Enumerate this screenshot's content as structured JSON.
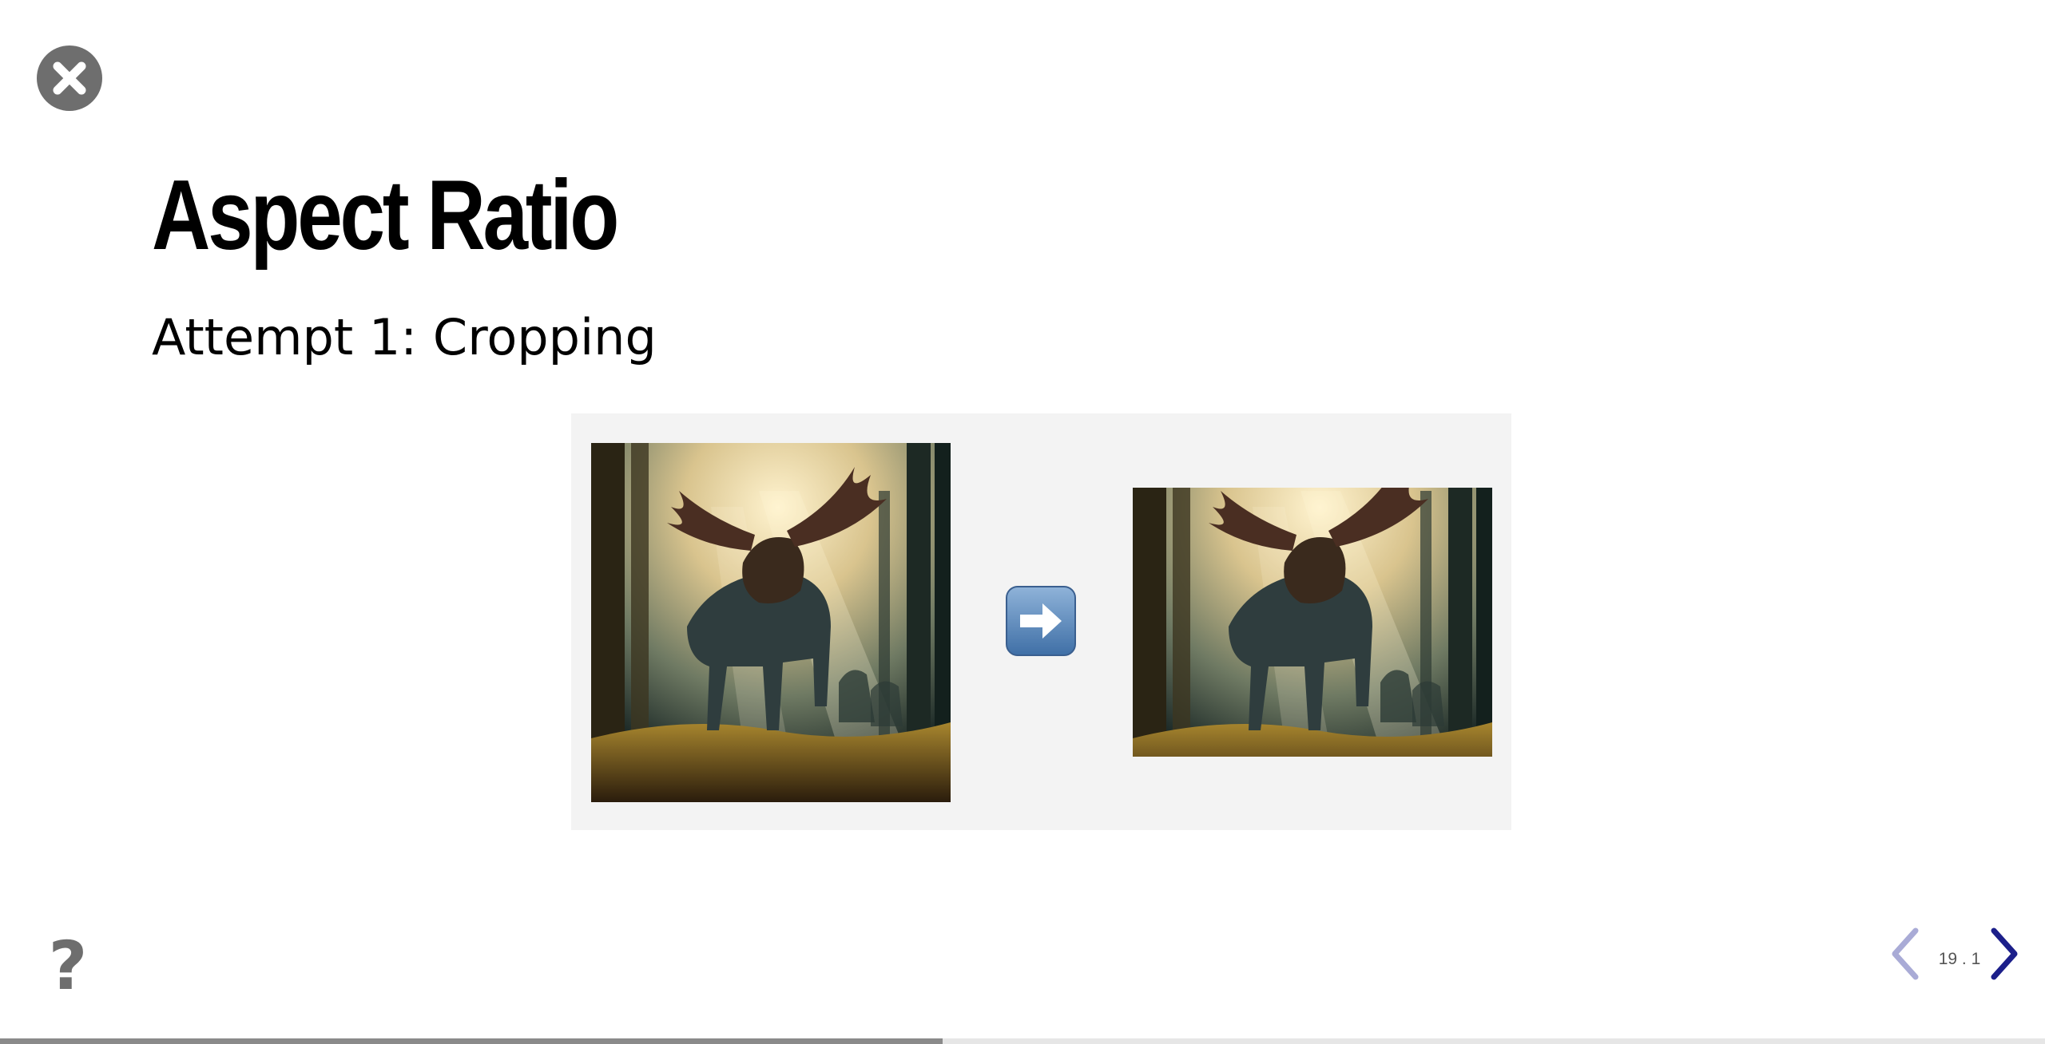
{
  "slide": {
    "title": "Aspect Ratio",
    "subtitle": "Attempt 1: Cropping"
  },
  "controls": {
    "close_icon": "close-icon",
    "help_label": "?",
    "prev_icon": "chevron-left-icon",
    "next_icon": "chevron-right-icon",
    "slide_number": "19 . 1"
  },
  "progress": {
    "fraction": 0.461
  },
  "colors": {
    "nav_active": "#1c1f8a",
    "nav_disabled": "#a9abd6",
    "control_gray": "#6e6e6e",
    "panel_bg": "#f3f3f3"
  }
}
